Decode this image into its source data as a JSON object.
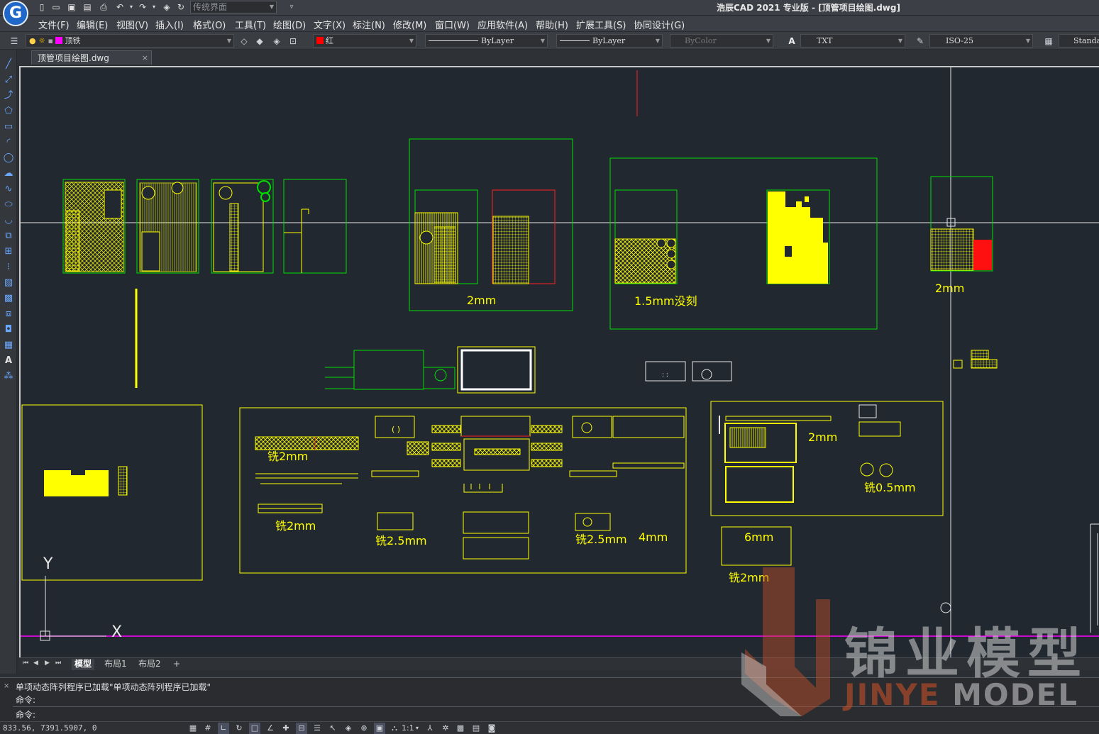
{
  "app": {
    "logo_letter": "G",
    "title": "浩辰CAD 2021 专业版 - [顶管项目绘图.dwg]",
    "workspace": "传统界面"
  },
  "menu": [
    "文件(F)",
    "编辑(E)",
    "视图(V)",
    "插入(I)",
    "格式(O)",
    "工具(T)",
    "绘图(D)",
    "文字(X)",
    "标注(N)",
    "修改(M)",
    "窗口(W)",
    "应用软件(A)",
    "帮助(H)",
    "扩展工具(S)",
    "协同设计(G)"
  ],
  "properties": {
    "layer": "顶铁",
    "layer_color": "#ff00ff",
    "color": "红",
    "color_swatch": "#ff0000",
    "linetype": "ByLayer",
    "lineweight": "ByLayer",
    "plotstyle": "ByColor",
    "text_style": "TXT",
    "dim_style": "ISO-25",
    "table_style": "Standa"
  },
  "document": {
    "tab_name": "顶管项目绘图.dwg",
    "close_glyph": "×"
  },
  "layout_tabs": [
    "模型",
    "布局1",
    "布局2",
    "+"
  ],
  "drawing": {
    "labels": {
      "l1": "2mm",
      "l2": "1.5mm没刻",
      "l3": "2mm",
      "l4": "铣2mm",
      "l5": "铣2mm",
      "l6": "铣2.5mm",
      "l7": "铣2.5mm",
      "l8": "4mm",
      "l9": "2mm",
      "l10": "铣0.5mm",
      "l11": "6mm",
      "l12": "铣2mm"
    },
    "ucs": {
      "y": "Y",
      "x": "X"
    }
  },
  "command": {
    "history": "单项动态阵列程序已加载\"单项动态阵列程序已加载\"",
    "prompt1": "命令:",
    "prompt2": "命令:"
  },
  "status": {
    "coords": "833.56, 7391.5907, 0",
    "scale": "1:1"
  },
  "watermark": {
    "cn": "锦业模型",
    "en1": "JINYE",
    "en2": " MODEL"
  }
}
